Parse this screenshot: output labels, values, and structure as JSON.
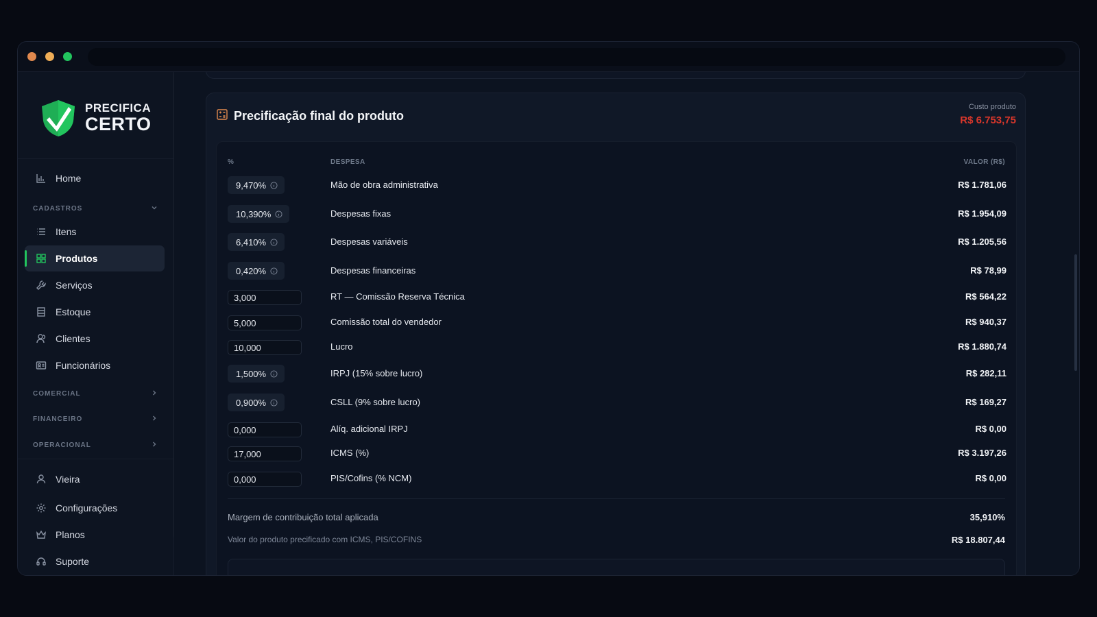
{
  "brand": {
    "line1": "PRECIFICA",
    "line2": "CERTO",
    "accent": "#22c55e"
  },
  "sidebar": {
    "home": {
      "label": "Home",
      "icon": "chart-bar-icon"
    },
    "sections": {
      "cadastros": "CADASTROS",
      "comercial": "COMERCIAL",
      "financeiro": "FINANCEIRO",
      "operacional": "OPERACIONAL"
    },
    "cadastros_items": [
      {
        "label": "Itens",
        "icon": "list-icon"
      },
      {
        "label": "Produtos",
        "icon": "grid-icon",
        "active": true
      },
      {
        "label": "Serviços",
        "icon": "wrench-icon"
      },
      {
        "label": "Estoque",
        "icon": "archive-icon"
      },
      {
        "label": "Clientes",
        "icon": "users-icon"
      },
      {
        "label": "Funcionários",
        "icon": "id-card-icon"
      }
    ],
    "footer_items": [
      {
        "label": "Vieira",
        "icon": "user-icon"
      },
      {
        "label": "Configurações",
        "icon": "gear-icon"
      },
      {
        "label": "Planos",
        "icon": "crown-icon"
      },
      {
        "label": "Suporte",
        "icon": "headset-icon"
      }
    ]
  },
  "card": {
    "title": "Precificação final do produto",
    "cost_label": "Custo produto",
    "cost_value": "R$ 6.753,75",
    "cost_color": "#d9372b"
  },
  "table": {
    "headers": {
      "pct": "%",
      "despesa": "DESPESA",
      "valor": "VALOR (R$)"
    },
    "rows": [
      {
        "pct": "9,470%",
        "kind": "badge",
        "desc": "Mão de obra administrativa",
        "value": "R$ 1.781,06"
      },
      {
        "pct": "10,390%",
        "kind": "badge",
        "desc": "Despesas fixas",
        "value": "R$ 1.954,09"
      },
      {
        "pct": "6,410%",
        "kind": "badge",
        "desc": "Despesas variáveis",
        "value": "R$ 1.205,56"
      },
      {
        "pct": "0,420%",
        "kind": "badge",
        "desc": "Despesas financeiras",
        "value": "R$ 78,99"
      },
      {
        "pct": "3,000",
        "kind": "input",
        "desc": "RT — Comissão Reserva Técnica",
        "value": "R$ 564,22"
      },
      {
        "pct": "5,000",
        "kind": "input",
        "desc": "Comissão total do vendedor",
        "value": "R$ 940,37"
      },
      {
        "pct": "10,000",
        "kind": "input",
        "desc": "Lucro",
        "value": "R$ 1.880,74"
      },
      {
        "pct": "1,500%",
        "kind": "badge",
        "desc": "IRPJ (15% sobre lucro)",
        "value": "R$ 282,11"
      },
      {
        "pct": "0,900%",
        "kind": "badge",
        "desc": "CSLL (9% sobre lucro)",
        "value": "R$ 169,27"
      },
      {
        "pct": "0,000",
        "kind": "input",
        "desc": "Alíq. adicional IRPJ",
        "value": "R$ 0,00"
      },
      {
        "pct": "17,000",
        "kind": "input",
        "desc": "ICMS (%)",
        "value": "R$ 3.197,26"
      },
      {
        "pct": "0,000",
        "kind": "input",
        "desc": "PIS/Cofins (% NCM)",
        "value": "R$ 0,00"
      }
    ]
  },
  "summary": {
    "margin_label": "Margem de contribuição total aplicada",
    "margin_value": "35,910%",
    "price_label": "Valor do produto precificado com ICMS, PIS/COFINS",
    "price_value": "R$ 18.807,44"
  }
}
